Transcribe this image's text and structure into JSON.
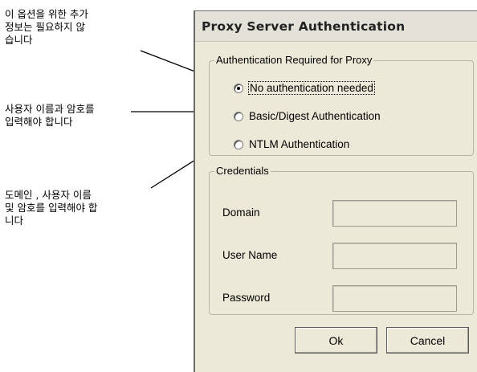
{
  "annotations": {
    "no_auth_note": "이 옵션을 위한 추가\n정보는 필요하지 않\n습니다",
    "basic_note": "사용자 이름과 암호를\n입력해야 합니다",
    "ntlm_note": "도메인 , 사용자 이름\n및 암호를 입력해야 합\n니다"
  },
  "dialog": {
    "title": "Proxy Server Authentication",
    "auth_group": {
      "legend": "Authentication Required for Proxy",
      "options": [
        {
          "label": "No authentication needed",
          "selected": true
        },
        {
          "label": "Basic/Digest Authentication",
          "selected": false
        },
        {
          "label": "NTLM Authentication",
          "selected": false
        }
      ]
    },
    "credentials_group": {
      "legend": "Credentials",
      "fields": [
        {
          "label": "Domain",
          "value": ""
        },
        {
          "label": "User Name",
          "value": ""
        },
        {
          "label": "Password",
          "value": ""
        }
      ]
    },
    "buttons": {
      "ok": "Ok",
      "cancel": "Cancel"
    }
  }
}
